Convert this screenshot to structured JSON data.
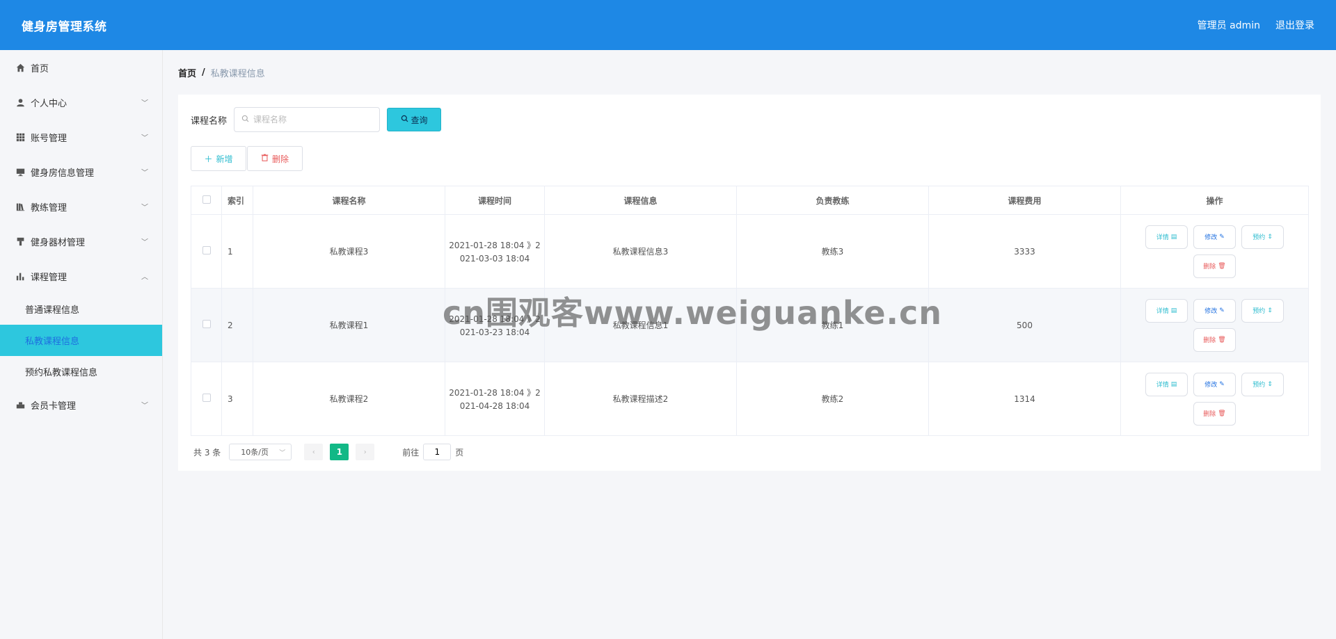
{
  "header": {
    "title": "健身房管理系统",
    "user": "管理员 admin",
    "logout": "退出登录"
  },
  "sidebar": {
    "items": [
      {
        "label": "首页",
        "icon": "home-icon"
      },
      {
        "label": "个人中心",
        "icon": "user-icon"
      },
      {
        "label": "账号管理",
        "icon": "grid-icon"
      },
      {
        "label": "健身房信息管理",
        "icon": "monitor-icon"
      },
      {
        "label": "教练管理",
        "icon": "book-icon"
      },
      {
        "label": "健身器材管理",
        "icon": "equipment-icon"
      },
      {
        "label": "课程管理",
        "icon": "chart-icon"
      },
      {
        "label": "会员卡管理",
        "icon": "card-icon"
      }
    ],
    "sub_items": [
      {
        "label": "普通课程信息"
      },
      {
        "label": "私教课程信息"
      },
      {
        "label": "预约私教课程信息"
      }
    ]
  },
  "breadcrumb": {
    "home": "首页",
    "sep": "/",
    "current": "私教课程信息"
  },
  "search": {
    "label": "课程名称",
    "placeholder": "课程名称",
    "button": "查询"
  },
  "actions": {
    "add": "新增",
    "delete": "删除"
  },
  "table": {
    "headers": [
      "索引",
      "课程名称",
      "课程时间",
      "课程信息",
      "负责教练",
      "课程费用",
      "操作"
    ],
    "rows": [
      {
        "index": "1",
        "name": "私教课程3",
        "time_line1": "2021-01-28 18:04 》2",
        "time_line2": "021-03-03 18:04",
        "info": "私教课程信息3",
        "coach": "教练3",
        "fee": "3333"
      },
      {
        "index": "2",
        "name": "私教课程1",
        "time_line1": "2021-01-28 18:04 》2",
        "time_line2": "021-03-23 18:04",
        "info": "私教课程信息1",
        "coach": "教练1",
        "fee": "500"
      },
      {
        "index": "3",
        "name": "私教课程2",
        "time_line1": "2021-01-28 18:04 》2",
        "time_line2": "021-04-28 18:04",
        "info": "私教课程描述2",
        "coach": "教练2",
        "fee": "1314"
      }
    ],
    "ops": {
      "detail": "详情",
      "edit": "修改",
      "book": "预约",
      "delete": "删除"
    }
  },
  "pager": {
    "total": "共 3 条",
    "page_size": "10条/页",
    "current_page": "1",
    "goto_label": "前往",
    "goto_value": "1",
    "page_suffix": "页"
  },
  "watermark": "cn围观客www.weiguanke.cn"
}
